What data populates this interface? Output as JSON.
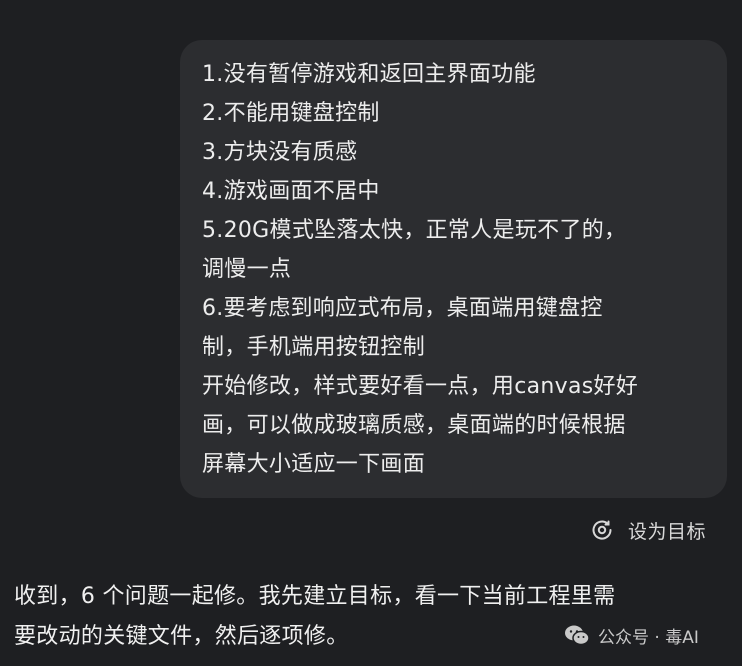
{
  "user_message": {
    "lines": [
      "1.没有暂停游戏和返回主界面功能",
      "2.不能用键盘控制",
      "3.方块没有质感",
      "4.游戏画面不居中",
      "5.20G模式坠落太快，正常人是玩不了的，",
      "调慢一点",
      "6.要考虑到响应式布局，桌面端用键盘控",
      "制，手机端用按钮控制",
      "开始修改，样式要好看一点，用canvas好好",
      "画，可以做成玻璃质感，桌面端的时候根据",
      "屏幕大小适应一下画面"
    ]
  },
  "set_goal": {
    "label": "设为目标",
    "icon": "target-refresh-icon"
  },
  "assistant_message": {
    "lines": [
      "收到，6 个问题一起修。我先建立目标，看一下当前工程里需",
      "要改动的关键文件，然后逐项修。"
    ]
  },
  "watermark": {
    "text": "公众号 · 毒AI",
    "icon": "wechat-icon"
  },
  "colors": {
    "background": "#1e1f22",
    "bubble": "#2c2d30",
    "text": "#ececec"
  }
}
